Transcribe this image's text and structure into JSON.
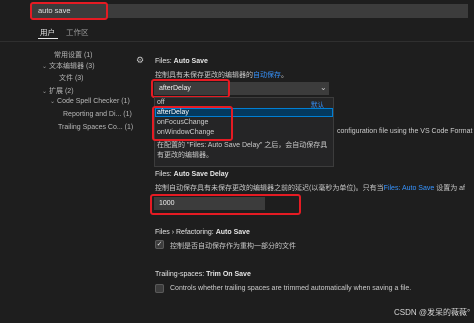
{
  "search": {
    "value": "auto save"
  },
  "tabs": [
    {
      "label": "用户"
    },
    {
      "label": "工作区"
    }
  ],
  "tree": [
    {
      "label": "常用设置 (1)"
    },
    {
      "label": "文本编辑器 (3)"
    },
    {
      "label": "文件 (3)"
    },
    {
      "label": "扩展 (2)"
    },
    {
      "label": "Code Spell Checker (1)"
    },
    {
      "label": "Reporting and Di... (1)"
    },
    {
      "label": "Trailing Spaces Co... (1)"
    }
  ],
  "auto_save": {
    "title_prefix": "Files: ",
    "title_bold": "Auto Save",
    "desc": "控制具有未保存更改的编辑器的",
    "desc_link": "自动保存",
    "desc_end": "。",
    "selected": "afterDelay",
    "options": [
      {
        "label": "off"
      },
      {
        "label": "afterDelay"
      },
      {
        "label": "onFocusChange"
      },
      {
        "label": "onWindowChange"
      }
    ],
    "default_tag": "默认",
    "option_description": "在配置的 \"Files: Auto Save Delay\" 之后，会自动保存具有更改的编辑器。"
  },
  "config_note": "configuration file using the VS Code Format",
  "auto_save_delay": {
    "title_prefix": "Files: ",
    "title_bold": "Auto Save Delay",
    "desc": "控制自动保存具有未保存更改的编辑器之前的延迟(以毫秒为单位)。只有当",
    "desc_link": "Files: Auto Save",
    "desc_end": "设置为 af",
    "value": "1000"
  },
  "refactoring_auto_save": {
    "title_prefix": "Files › Refactoring: ",
    "title_bold": "Auto Save",
    "desc": "控制是否自动保存作为重构一部分的文件",
    "checked": true,
    "check_glyph": "✓"
  },
  "trim_on_save": {
    "title_prefix": "Trailing-spaces: ",
    "title_bold": "Trim On Save",
    "desc": "Controls whether trailing spaces are trimmed automatically when saving a file.",
    "checked": false
  },
  "watermark": "CSDN @发呆的薇薇°",
  "icons": {
    "gear": "gear-icon",
    "chevron": "chevron-down-icon"
  },
  "colors": {
    "highlight": "#e51b23",
    "link": "#3794ff",
    "selected_bg": "#04395e"
  }
}
